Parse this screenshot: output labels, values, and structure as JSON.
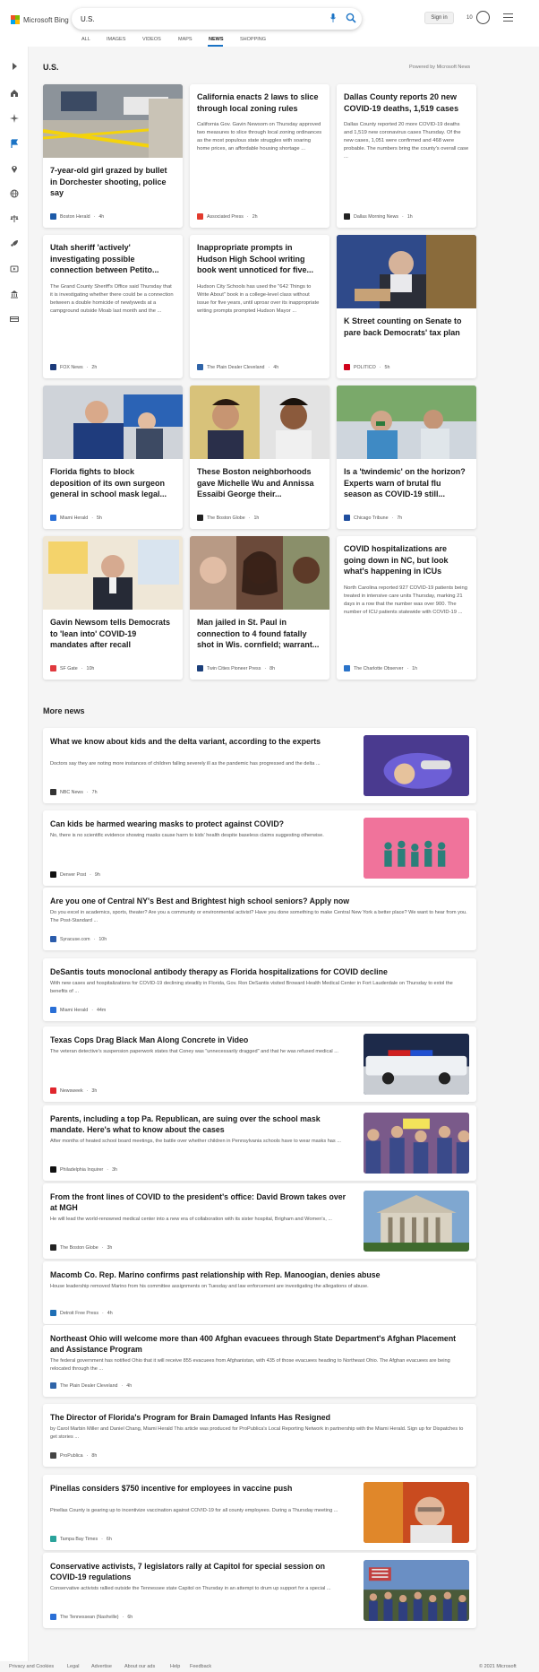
{
  "header": {
    "logo_text": "Microsoft Bing",
    "search_value": "U.S.",
    "signin_label": "Sign in",
    "reward_points": "10"
  },
  "tabs": [
    {
      "label": "ALL"
    },
    {
      "label": "IMAGES"
    },
    {
      "label": "VIDEOS"
    },
    {
      "label": "MAPS"
    },
    {
      "label": "NEWS"
    },
    {
      "label": "SHOPPING"
    }
  ],
  "active_tab": "NEWS",
  "section": {
    "title": "U.S.",
    "powered_by": "Powered by Microsoft News"
  },
  "cards": [
    {
      "title": "7-year-old girl grazed by bullet in Dorchester shooting, police say",
      "snippet": "",
      "source": "Boston Herald",
      "age": "4h",
      "fav_color": "#1d5aa8",
      "image": "crime-scene"
    },
    {
      "title": "California enacts 2 laws to slice through local zoning rules",
      "snippet": "California Gov. Gavin Newsom on Thursday approved two measures to slice through local zoning ordinances as the most populous state struggles with soaring home prices, an affordable housing shortage ...",
      "source": "Associated Press",
      "age": "2h",
      "fav_color": "#e23b2e",
      "image": ""
    },
    {
      "title": "Dallas County reports 20 new COVID-19 deaths, 1,519 cases",
      "snippet": "Dallas County reported 20 more COVID-19 deaths and 1,519 new coronavirus cases Thursday. Of the new cases, 1,051 were confirmed and 468 were probable. The numbers bring the county's overall case ...",
      "source": "Dallas Morning News",
      "age": "1h",
      "fav_color": "#222222",
      "image": ""
    },
    {
      "title": "Utah sheriff 'actively' investigating possible connection between Petito...",
      "snippet": "The Grand County Sheriff's Office said Thursday that it is investigating whether there could be a connection between a double homicide of newlyweds at a campground outside Moab last month and the ...",
      "source": "FOX News",
      "age": "2h",
      "fav_color": "#1b3a7a",
      "image": ""
    },
    {
      "title": "Inappropriate prompts in Hudson High School writing book went unnoticed for five...",
      "snippet": "Hudson City Schools has used the \"642 Things to Write About\" book in a college-level class without issue for five years, until uproar over its inappropriate writing prompts prompted Hudson Mayor ...",
      "source": "The Plain Dealer Cleveland",
      "age": "4h",
      "fav_color": "#2f64a8",
      "image": ""
    },
    {
      "title": "K Street counting on Senate to pare back Democrats' tax plan",
      "snippet": "",
      "source": "POLITICO",
      "age": "5h",
      "fav_color": "#d0021b",
      "image": "senator"
    },
    {
      "title": "Florida fights to block deposition of its own surgeon general in school mask legal...",
      "snippet": "",
      "source": "Miami Herald",
      "age": "5h",
      "fav_color": "#2a6fd6",
      "image": "florida"
    },
    {
      "title": "These Boston neighborhoods gave Michelle Wu and Annissa Essaibi George their...",
      "snippet": "",
      "source": "The Boston Globe",
      "age": "1h",
      "fav_color": "#222222",
      "image": "boston"
    },
    {
      "title": "Is a 'twindemic' on the horizon? Experts warn of brutal flu season as COVID-19 still...",
      "snippet": "",
      "source": "Chicago Tribune",
      "age": "7h",
      "fav_color": "#1f4e9e",
      "image": "vaccine"
    },
    {
      "title": "Gavin Newsom tells Democrats to 'lean into' COVID-19 mandates after recall",
      "snippet": "",
      "source": "SF Gate",
      "age": "10h",
      "fav_color": "#e0393e",
      "image": "newsom"
    },
    {
      "title": "Man jailed in St. Paul in connection to 4 found fatally shot in Wis. cornfield; warrant...",
      "snippet": "",
      "source": "Twin Cities Pioneer Press",
      "age": "8h",
      "fav_color": "#1b3f7a",
      "image": "faces"
    },
    {
      "title": "COVID hospitalizations are going down in NC, but look what's happening in ICUs",
      "snippet": "North Carolina reported 927 COVID-19 patients being treated in intensive care units Thursday, marking 21 days in a row that the number was over 900. The number of ICU patients statewide with COVID-19 ...",
      "source": "The Charlotte Observer",
      "age": "1h",
      "fav_color": "#2a73c9",
      "image": ""
    }
  ],
  "more_news_title": "More news",
  "more_news": [
    {
      "title": "What we know about kids and the delta variant, according to the experts",
      "snippet": "Doctors say they are noting more instances of children falling severely ill as the pandemic has progressed and the delta ...",
      "source": "NBC News",
      "age": "7h",
      "fav_color": "#333333",
      "image": "gloves"
    },
    {
      "title": "Can kids be harmed wearing masks to protect against COVID?",
      "snippet": "No, there is no scientific evidence showing masks cause harm to kids' health despite baseless claims suggesting otherwise.",
      "source": "Denver Post",
      "age": "9h",
      "fav_color": "#111111",
      "image": "pink"
    },
    {
      "title": "Are you one of Central NY's Best and Brightest high school seniors? Apply now",
      "snippet": "Do you excel in academics, sports, theater? Are you a community or environmental activist? Have you done something to make Central New York a better place? We want to hear from you. The Post-Standard ...",
      "source": "Syracuse.com",
      "age": "10h",
      "fav_color": "#2b5cab",
      "image": ""
    },
    {
      "title": "DeSantis touts monoclonal antibody therapy as Florida hospitalizations for COVID decline",
      "snippet": "With new cases and hospitalizations for COVID-19 declining steadily in Florida, Gov. Ron DeSantis visited Broward Health Medical Center in Fort Lauderdale on Thursday to extol the benefits of ...",
      "source": "Miami Herald",
      "age": "44m",
      "fav_color": "#2a6fd6",
      "image": ""
    },
    {
      "title": "Texas Cops Drag Black Man Along Concrete in Video",
      "snippet": "The veteran detective's suspension paperwork states that Coney was \"unnecessarily dragged\" and that he was refused medical ...",
      "source": "Newsweek",
      "age": "3h",
      "fav_color": "#e0262d",
      "image": "police"
    },
    {
      "title": "Parents, including a top Pa. Republican, are suing over the school mask mandate. Here's what to know about the cases",
      "snippet": "After months of heated school board meetings, the battle over whether children in Pennsylvania schools have to wear masks has ...",
      "source": "Philadelphia Inquirer",
      "age": "3h",
      "fav_color": "#111111",
      "image": "protest"
    },
    {
      "title": "From the front lines of COVID to the president's office: David Brown takes over at MGH",
      "snippet": "He will lead the world-renowned medical center into a new era of collaboration with its sister hospital, Brigham and Women's, ...",
      "source": "The Boston Globe",
      "age": "3h",
      "fav_color": "#222222",
      "image": "building"
    },
    {
      "title": "Macomb Co. Rep. Marino confirms past relationship with Rep. Manoogian, denies abuse",
      "snippet": "House leadership removed Marino from his committee assignments on Tuesday and law enforcement are investigating the allegations of abuse.",
      "source": "Detroit Free Press",
      "age": "4h",
      "fav_color": "#1f6fb5",
      "image": ""
    },
    {
      "title": "Northeast Ohio will welcome more than 400 Afghan evacuees through State Department's Afghan Placement and Assistance Program",
      "snippet": "The federal government has notified Ohio that it will receive 855 evacuees from Afghanistan, with 435 of those evacuees heading to Northeast Ohio. The Afghan evacuees are being relocated through the ...",
      "source": "The Plain Dealer Cleveland",
      "age": "4h",
      "fav_color": "#2f64a8",
      "image": ""
    },
    {
      "title": "The Director of Florida's Program for Brain Damaged Infants Has Resigned",
      "snippet": "by Carol Marbin Miller and Daniel Chang, Miami Herald This article was produced for ProPublica's Local Reporting Network in partnership with the Miami Herald. Sign up for Dispatches to get stories ...",
      "source": "ProPublica",
      "age": "8h",
      "fav_color": "#444444",
      "image": ""
    },
    {
      "title": "Pinellas considers $750 incentive for employees in vaccine push",
      "snippet": "Pinellas County is gearing up to incentivize vaccination against COVID-19 for all county employees. During a Thursday meeting ...",
      "source": "Tampa Bay Times",
      "age": "6h",
      "fav_color": "#2aa39b",
      "image": "man"
    },
    {
      "title": "Conservative activists, 7 legislators rally at Capitol for special session on COVID-19 regulations",
      "snippet": "Conservative activists rallied outside the Tennessee state Capitol on Thursday in an attempt to drum up support for a special ...",
      "source": "The Tennessean (Nashville)",
      "age": "6h",
      "fav_color": "#2a6fd6",
      "image": "rally"
    }
  ],
  "footer": {
    "links": [
      "Privacy and Cookies",
      "Legal",
      "Advertise",
      "About our ads",
      "Help",
      "Feedback"
    ],
    "copyright": "© 2021 Microsoft"
  },
  "colors": {
    "accent": "#1a73c5",
    "page_bg": "#f5f5f5"
  }
}
